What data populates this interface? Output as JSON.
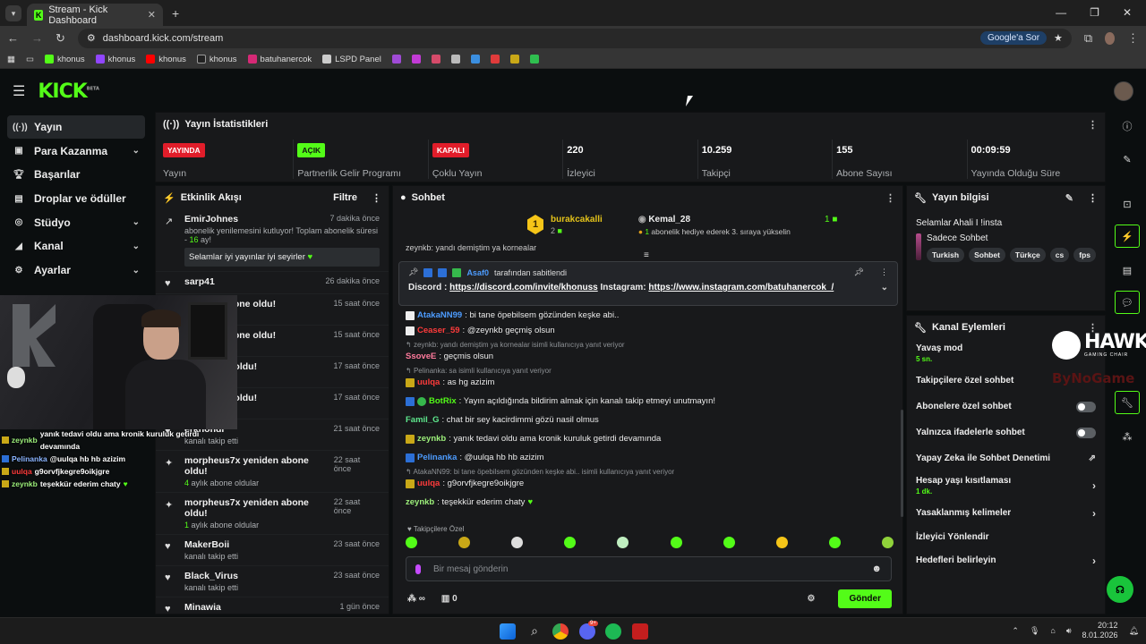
{
  "browser": {
    "tab_title": "Stream - Kick Dashboard",
    "url": "dashboard.kick.com/stream",
    "google_btn": "Google'a Sor",
    "bookmarks": [
      "khonus",
      "khonus",
      "khonus",
      "khonus",
      "batuhanercok",
      "LSPD Panel"
    ]
  },
  "header": {
    "logo": "KICK",
    "beta": "BETA"
  },
  "sidebar": {
    "items": [
      {
        "label": "Yayın",
        "icon": "broadcast-icon"
      },
      {
        "label": "Para Kazanma",
        "icon": "money-icon"
      },
      {
        "label": "Başarılar",
        "icon": "trophy-icon"
      },
      {
        "label": "Droplar ve ödüller",
        "icon": "gift-icon"
      },
      {
        "label": "Stüdyo",
        "icon": "studio-icon"
      },
      {
        "label": "Kanal",
        "icon": "channel-icon"
      },
      {
        "label": "Ayarlar",
        "icon": "gear-icon"
      }
    ]
  },
  "stats": {
    "title": "Yayın İstatistikleri",
    "items": [
      {
        "badge": "YAYINDA",
        "label": "Yayın"
      },
      {
        "badge": "AÇIK",
        "label": "Partnerlik Gelir Programı"
      },
      {
        "badge": "KAPALI",
        "label": "Çoklu Yayın"
      },
      {
        "value": "220",
        "label": "İzleyici"
      },
      {
        "value": "10.259",
        "label": "Takipçi"
      },
      {
        "value": "155",
        "label": "Abone Sayısı"
      },
      {
        "value": "00:09:59",
        "label": "Yayında Olduğu Süre"
      }
    ]
  },
  "events": {
    "title": "Etkinlik Akışı",
    "filter": "Filtre",
    "items": [
      {
        "name": "EmirJohnes",
        "time": "7 dakika önce",
        "sub": "abonelik yenilemesini kutluyor! Toplam abonelik süresi - ",
        "sub_hl": "16",
        "sub_end": " ay!",
        "msg": "Selamlar iyi yayınlar iyi seyirler"
      },
      {
        "name": "sarp41",
        "time": "26 dakika önce",
        "sub": ""
      },
      {
        "name": "yeniden abone oldu!",
        "time": "15 saat önce",
        "sub": "oldular"
      },
      {
        "name": "yeniden abone oldu!",
        "time": "15 saat önce",
        "sub": "oldular"
      },
      {
        "name": "den abone oldu!",
        "time": "17 saat önce",
        "sub": "oldular"
      },
      {
        "name": "den abone oldu!",
        "time": "17 saat önce",
        "sub": "oldular"
      },
      {
        "name": "erknondr",
        "time": "21 saat önce",
        "sub": "kanalı takip etti"
      },
      {
        "name": "morpheus7x yeniden abone oldu!",
        "time": "22 saat önce",
        "sub_hl": "4",
        "sub": " aylık abone oldular"
      },
      {
        "name": "morpheus7x yeniden abone oldu!",
        "time": "22 saat önce",
        "sub_hl": "1",
        "sub": " aylık abone oldular"
      },
      {
        "name": "MakerBoii",
        "time": "23 saat önce",
        "sub": "kanalı takip etti"
      },
      {
        "name": "Black_Virus",
        "time": "23 saat önce",
        "sub": "kanalı takip etti"
      },
      {
        "name": "Minawia",
        "time": "1 gün önce",
        "sub": ""
      }
    ]
  },
  "overlay": [
    {
      "user": "zeynkb",
      "text": "yanık tedavi oldu ama kronik kuruluk getirdi devamında",
      "color": "#9df07b"
    },
    {
      "user": "Pelinanka",
      "text": "@uulqa hb hb azizim",
      "color": "#8ab4ff"
    },
    {
      "user": "uulqa",
      "text": "g9orvfjkegre9oikjgre",
      "color": "#ff3b3b"
    },
    {
      "user": "zeynkb",
      "text": "teşekkür ederim chaty",
      "color": "#9df07b"
    }
  ],
  "chat": {
    "title": "Sohbet",
    "gift1": {
      "name": "burakcakalli",
      "count": "2"
    },
    "gift2": {
      "name": "Kemal_28",
      "count": "1",
      "sub_n": "1",
      "sub": " abonelik hediye ederek 3. sıraya yükselin"
    },
    "cut": "zeynkb: yandı demiştim ya kornealar",
    "pinned": {
      "by": "Asaf0",
      "text": "tarafından sabitlendi",
      "discord_lbl": "Discord : ",
      "discord": "https://discord.com/invite/khonuss",
      "insta_lbl": " Instagram: ",
      "insta": "https://www.instagram.com/batuhanercok_/"
    },
    "messages": [
      {
        "user": "AtakaNN99",
        "color": "#4d9cff",
        "text": ": bi tane öpebilsem gözünden keşke abi..",
        "badge": "w"
      },
      {
        "user": "Ceaser_59",
        "color": "#ff3b3b",
        "text": ": @zeynkb geçmiş olsun",
        "badge": "w"
      },
      {
        "reply": "zeynkb: yandı demiştim ya kornealar isimli kullanıcıya yanıt veriyor"
      },
      {
        "user": "SsoveE",
        "color": "#ff7a9c",
        "text": ": geçmis olsun",
        "badge": ""
      },
      {
        "reply": "Pelinanka: sa isimli kullanıcıya yanıt veriyor"
      },
      {
        "user": "uulqa",
        "color": "#ff3b3b",
        "text": ": as hg azizim",
        "badge": "y"
      },
      {
        "user": "BotRix",
        "color": "#53fc18",
        "text": ": Yayın açıldığında bildirim almak için kanalı takip etmeyi unutmayın!",
        "badge": "b"
      },
      {
        "user": "Famil_G",
        "color": "#5ee88d",
        "text": ": chat bir sey kacirdimmi gözü nasil olmus",
        "badge": ""
      },
      {
        "user": "zeynkb",
        "color": "#9df07b",
        "text": ": yanık tedavi oldu ama kronik kuruluk getirdi devamında",
        "badge": "y"
      },
      {
        "user": "Pelinanka",
        "color": "#4d9cff",
        "text": ": @uulqa hb hb azizim",
        "badge": "b"
      },
      {
        "reply": "AtakaNN99: bi tane öpebilsem gözünden keşke abi.. isimli kullanıcıya yanıt veriyor"
      },
      {
        "user": "uulqa",
        "color": "#ff3b3b",
        "text": ": g9orvfjkegre9oikjgre",
        "badge": "y"
      },
      {
        "user": "zeynkb",
        "color": "#9df07b",
        "text": ": teşekkür ederim chaty",
        "badge": ""
      }
    ],
    "followers_label": "Takipçilere Özel",
    "input_placeholder": "Bir mesaj gönderin",
    "points": "∞",
    "count": "0",
    "send": "Gönder"
  },
  "info": {
    "title": "Yayın bilgisi",
    "stream_title": "Selamlar Ahali I !insta",
    "category": "Sadece Sohbet",
    "tags": [
      "Turkish",
      "Sohbet",
      "Türkçe",
      "cs",
      "fps"
    ]
  },
  "actions": {
    "title": "Kanal Eylemleri",
    "items": [
      {
        "label": "Yavaş mod",
        "sub": "5 sn."
      },
      {
        "label": "Takipçilere özel sohbet"
      },
      {
        "label": "Abonelere özel sohbet",
        "toggle": true
      },
      {
        "label": "Yalnızca ifadelerle sohbet",
        "toggle": true
      },
      {
        "label": "Yapay Zeka ile Sohbet Denetimi"
      },
      {
        "label": "Hesap yaşı kısıtlaması",
        "sub": "1 dk."
      },
      {
        "label": "Yasaklanmış kelimeler"
      },
      {
        "label": "İzleyici Yönlendir"
      },
      {
        "label": "Hedefleri belirleyin"
      }
    ]
  },
  "watermark": {
    "brand": "HAWK",
    "sub": "GAMING CHAIR",
    "by": "ByNoGame"
  },
  "taskbar": {
    "time": "20:12",
    "date": "8.01.2026",
    "badge": "9+"
  },
  "colors": {
    "accent": "#53fc18",
    "live": "#e11d2a"
  }
}
